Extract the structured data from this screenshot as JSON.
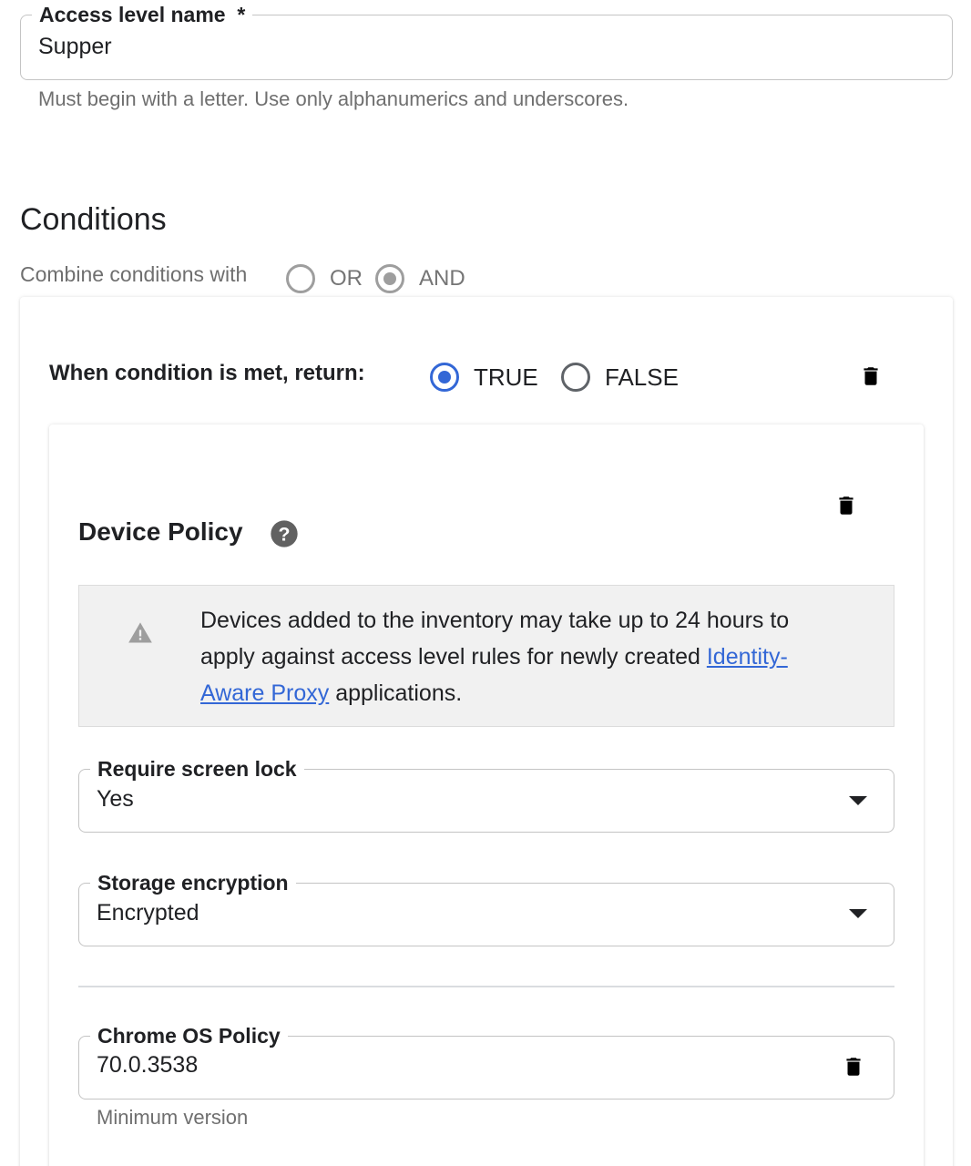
{
  "access_level": {
    "label": "Access level name",
    "required_marker": "*",
    "value": "Supper",
    "helper": "Must begin with a letter. Use only alphanumerics and underscores."
  },
  "conditions": {
    "title": "Conditions",
    "combine_label": "Combine conditions with",
    "combine_options": [
      {
        "label": "OR",
        "selected": false
      },
      {
        "label": "AND",
        "selected": true
      }
    ],
    "condition": {
      "return_label": "When condition is met, return:",
      "return_options": [
        {
          "label": "TRUE",
          "selected": true
        },
        {
          "label": "FALSE",
          "selected": false
        }
      ],
      "device_policy": {
        "title": "Device Policy",
        "notice": {
          "text_before": "Devices added to the inventory may take up to 24 hours to apply against access level rules for newly created ",
          "link_text": "Identity-Aware Proxy",
          "text_after": " applications."
        },
        "screen_lock": {
          "label": "Require screen lock",
          "value": "Yes"
        },
        "storage_encryption": {
          "label": "Storage encryption",
          "value": "Encrypted"
        },
        "chrome_os": {
          "label": "Chrome OS Policy",
          "value": "70.0.3538",
          "helper": "Minimum version"
        }
      }
    }
  },
  "icons": {
    "delete": "trash-icon",
    "help": "help-circle-icon",
    "warning": "warning-triangle-icon",
    "dropdown": "arrow-drop-down-icon"
  },
  "colors": {
    "accent": "#3367d6",
    "disabled_radio": "#9e9e9e",
    "notice_bg": "#f1f1f1"
  }
}
